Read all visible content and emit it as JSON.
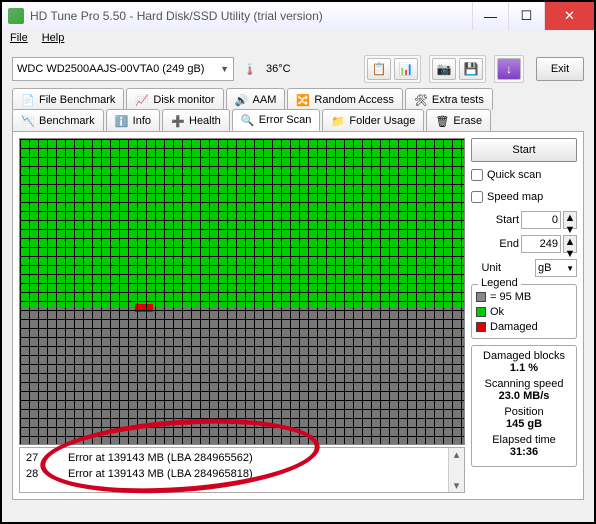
{
  "window": {
    "title": "HD Tune Pro 5.50 - Hard Disk/SSD Utility (trial version)"
  },
  "menu": {
    "file": "File",
    "help": "Help"
  },
  "toolbar": {
    "drive": "WDC WD2500AAJS-00VTA0 (249 gB)",
    "temp": "36°C",
    "exit": "Exit"
  },
  "tabs_top": {
    "filebench": "File Benchmark",
    "diskmon": "Disk monitor",
    "aam": "AAM",
    "random": "Random Access",
    "extra": "Extra tests"
  },
  "tabs_bot": {
    "benchmark": "Benchmark",
    "info": "Info",
    "health": "Health",
    "errorscan": "Error Scan",
    "folder": "Folder Usage",
    "erase": "Erase"
  },
  "scan": {
    "start_btn": "Start",
    "quick": "Quick scan",
    "speedmap": "Speed map",
    "start_lbl": "Start",
    "start_val": "0",
    "end_lbl": "End",
    "end_val": "249",
    "unit_lbl": "Unit",
    "unit_val": "gB",
    "legend": "Legend",
    "blocksize": "= 95 MB",
    "ok": "Ok",
    "damaged": "Damaged"
  },
  "stats": {
    "dmg_lbl": "Damaged blocks",
    "dmg_val": "1.1 %",
    "spd_lbl": "Scanning speed",
    "spd_val": "23.0 MB/s",
    "pos_lbl": "Position",
    "pos_val": "145 gB",
    "elp_lbl": "Elapsed time",
    "elp_val": "31:36"
  },
  "errors": [
    {
      "n": "27",
      "msg": "Error at 139143 MB (LBA 284965562)"
    },
    {
      "n": "28",
      "msg": "Error at 139143 MB (LBA 284965818)"
    }
  ]
}
